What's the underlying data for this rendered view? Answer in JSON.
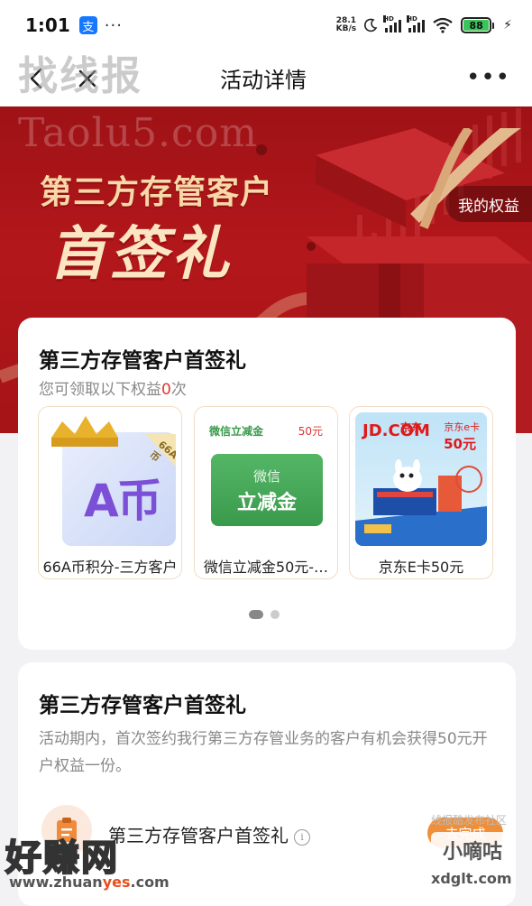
{
  "status_bar": {
    "time": "1:01",
    "app_badge": "支",
    "more": "···",
    "net_speed_value": "28.1",
    "net_speed_unit": "KB/s",
    "signal_tag": "HD",
    "battery": "88"
  },
  "nav": {
    "title": "活动详情",
    "more": "•••"
  },
  "watermarks": {
    "top": "找线报",
    "taolu": "Taolu5.com",
    "haozhuan": "好赚网",
    "url_prefix": "www.zhuan",
    "url_highlight": "yes",
    "url_suffix": ".com",
    "xiaodigu": "小嘀咕",
    "xdglt": "xdglt.com",
    "small_text": "线报酷发布社区"
  },
  "banner": {
    "line1": "第三方存管客户",
    "line2": "首签礼",
    "my_rights": "我的权益"
  },
  "rewards_card": {
    "title": "第三方存管客户首签礼",
    "subtitle_prefix": "您可领取以下权益",
    "subtitle_count": "0",
    "subtitle_suffix": "次",
    "items": [
      {
        "name": "66A币积分-三方客户",
        "img_text": "A币",
        "badge": "66A币"
      },
      {
        "name": "微信立减金50元-…",
        "img_header": "微信立减金",
        "img_amount": "50元",
        "img_card_line1": "微信",
        "img_card_line2": "立减金"
      },
      {
        "name": "京东E卡50元",
        "img_brand": "JD.COM",
        "img_brand_cn": "京东",
        "img_card_tag": "京东e卡",
        "img_amount": "50元"
      }
    ],
    "pager": {
      "active": 1,
      "total": 2
    }
  },
  "info_card": {
    "title": "第三方存管客户首签礼",
    "description": "活动期内，首次签约我行第三方存管业务的客户有机会获得50元开户权益一份。",
    "task_label": "第三方存管客户首签礼",
    "task_button": "去完成"
  },
  "colors": {
    "banner_red": "#b3171b",
    "gold_text": "#f7d8a8",
    "accent_orange": "#ef8f3a",
    "count_red": "#e5322d"
  }
}
